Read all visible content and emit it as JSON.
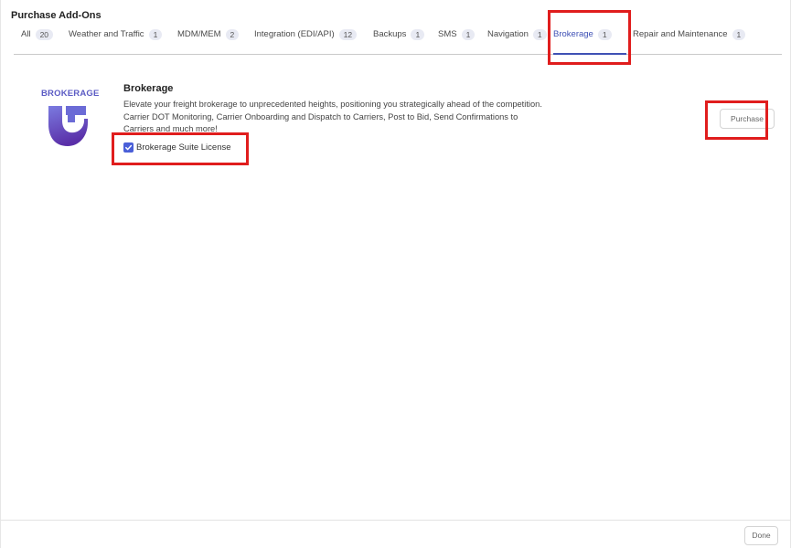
{
  "modal": {
    "title": "Purchase Add-Ons"
  },
  "tabs": [
    {
      "label": "All",
      "count": "20",
      "active": false
    },
    {
      "label": "Weather and Traffic",
      "count": "1",
      "active": false
    },
    {
      "label": "MDM/MEM",
      "count": "2",
      "active": false
    },
    {
      "label": "Integration (EDI/API)",
      "count": "12",
      "active": false
    },
    {
      "label": "Backups",
      "count": "1",
      "active": false
    },
    {
      "label": "SMS",
      "count": "1",
      "active": false
    },
    {
      "label": "Navigation",
      "count": "1",
      "active": false
    },
    {
      "label": "Brokerage",
      "count": "1",
      "active": true
    },
    {
      "label": "Repair and Maintenance",
      "count": "1",
      "active": false
    }
  ],
  "addon": {
    "logo_text": "BROKERAGE",
    "logo_icon": "brokerage-shield-logo",
    "title": "Brokerage",
    "description": "Elevate your freight brokerage to unprecedented heights, positioning you strategically ahead of the competition. Carrier DOT Monitoring, Carrier Onboarding and Dispatch to Carriers, Post to Bid, Send Confirmations to Carriers and much more!",
    "license_label": "Brokerage Suite License",
    "license_checked": true,
    "purchase_label": "Purchase"
  },
  "footer": {
    "done_label": "Done"
  },
  "colors": {
    "accent": "#3f51b5",
    "highlight": "#e01d1d",
    "logo": "#5b5bc4"
  }
}
